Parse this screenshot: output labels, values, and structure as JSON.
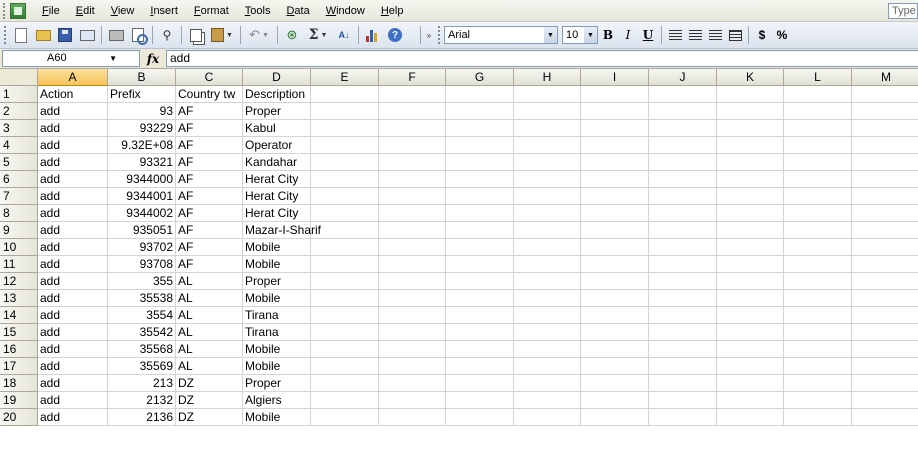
{
  "menu": {
    "items": [
      {
        "label": "File",
        "name": "menu-file"
      },
      {
        "label": "Edit",
        "name": "menu-edit"
      },
      {
        "label": "View",
        "name": "menu-view"
      },
      {
        "label": "Insert",
        "name": "menu-insert"
      },
      {
        "label": "Format",
        "name": "menu-format"
      },
      {
        "label": "Tools",
        "name": "menu-tools"
      },
      {
        "label": "Data",
        "name": "menu-data"
      },
      {
        "label": "Window",
        "name": "menu-window"
      },
      {
        "label": "Help",
        "name": "menu-help"
      }
    ],
    "ask_placeholder": "Type a"
  },
  "toolbar": {
    "font_name": "Arial",
    "font_size": "10",
    "bold": "B",
    "italic": "I",
    "underline": "U",
    "sum": "Σ",
    "sort": "A↓",
    "currency": "$",
    "percent": "%"
  },
  "formula_bar": {
    "name_box": "A60",
    "fx": "fx",
    "value": "add"
  },
  "grid": {
    "columns": [
      "A",
      "B",
      "C",
      "D",
      "E",
      "F",
      "G",
      "H",
      "I",
      "J",
      "K",
      "L",
      "M"
    ],
    "active_column": "A",
    "rows": [
      {
        "n": "1",
        "a": "Action",
        "b": "Prefix",
        "c": "Country tw",
        "d": "Description"
      },
      {
        "n": "2",
        "a": "add",
        "b": "93",
        "c": "AF",
        "d": "Proper"
      },
      {
        "n": "3",
        "a": "add",
        "b": "93229",
        "c": "AF",
        "d": "Kabul"
      },
      {
        "n": "4",
        "a": "add",
        "b": "9.32E+08",
        "c": "AF",
        "d": "Operator"
      },
      {
        "n": "5",
        "a": "add",
        "b": "93321",
        "c": "AF",
        "d": "Kandahar"
      },
      {
        "n": "6",
        "a": "add",
        "b": "9344000",
        "c": "AF",
        "d": "Herat City"
      },
      {
        "n": "7",
        "a": "add",
        "b": "9344001",
        "c": "AF",
        "d": "Herat City"
      },
      {
        "n": "8",
        "a": "add",
        "b": "9344002",
        "c": "AF",
        "d": "Herat City"
      },
      {
        "n": "9",
        "a": "add",
        "b": "935051",
        "c": "AF",
        "d": "Mazar-I-Sharif"
      },
      {
        "n": "10",
        "a": "add",
        "b": "93702",
        "c": "AF",
        "d": "Mobile"
      },
      {
        "n": "11",
        "a": "add",
        "b": "93708",
        "c": "AF",
        "d": "Mobile"
      },
      {
        "n": "12",
        "a": "add",
        "b": "355",
        "c": "AL",
        "d": "Proper"
      },
      {
        "n": "13",
        "a": "add",
        "b": "35538",
        "c": "AL",
        "d": "Mobile"
      },
      {
        "n": "14",
        "a": "add",
        "b": "3554",
        "c": "AL",
        "d": "Tirana"
      },
      {
        "n": "15",
        "a": "add",
        "b": "35542",
        "c": "AL",
        "d": "Tirana"
      },
      {
        "n": "16",
        "a": "add",
        "b": "35568",
        "c": "AL",
        "d": "Mobile"
      },
      {
        "n": "17",
        "a": "add",
        "b": "35569",
        "c": "AL",
        "d": "Mobile"
      },
      {
        "n": "18",
        "a": "add",
        "b": "213",
        "c": "DZ",
        "d": "Proper"
      },
      {
        "n": "19",
        "a": "add",
        "b": "2132",
        "c": "DZ",
        "d": "Algiers"
      },
      {
        "n": "20",
        "a": "add",
        "b": "2136",
        "c": "DZ",
        "d": "Mobile"
      }
    ]
  }
}
